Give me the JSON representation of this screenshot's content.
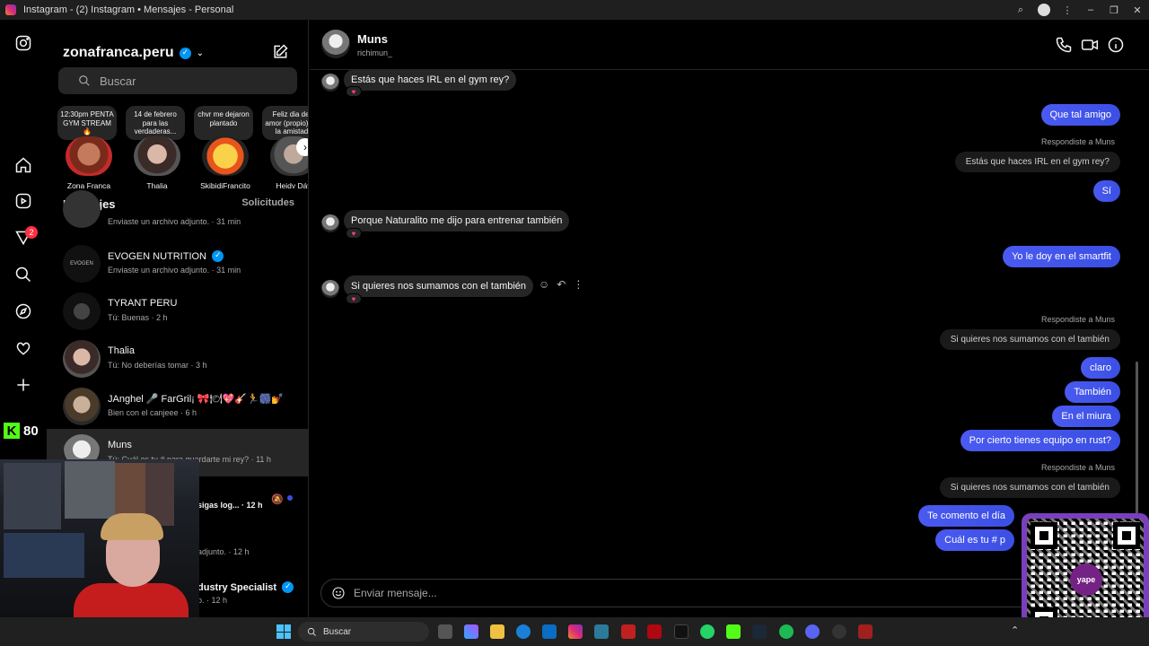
{
  "window": {
    "title": "Instagram - (2) Instagram • Mensajes - Personal"
  },
  "rail": {
    "notification_count": "2",
    "kick_count": "80"
  },
  "account": {
    "username": "zonafranca.peru"
  },
  "search": {
    "placeholder": "Buscar"
  },
  "notes": [
    {
      "text": "12:30pm PENTA GYM STREAM 🔥",
      "name": "Zona Franca"
    },
    {
      "text": "14 de febrero para las verdaderas...",
      "name": "Thalia"
    },
    {
      "text": "chvr me dejaron plantado",
      "name": "SkibidiFrancito"
    },
    {
      "text": "Feliz dia del amor (propio) de la amistad",
      "name": "Heidy Dáv"
    }
  ],
  "inbox": {
    "title": "Mensajes",
    "requests": "Solicitudes",
    "conversations": [
      {
        "name": "",
        "preview": "Enviaste un archivo adjunto. · 31 min"
      },
      {
        "name": "EVOGEN NUTRITION",
        "preview": "Enviaste un archivo adjunto. · 31 min",
        "avatar_text": "EVOGEN"
      },
      {
        "name": "TYRANT PERU",
        "preview": "Tú: Buenas · 2 h"
      },
      {
        "name": "Thalia",
        "preview": "Tú: No deberías tomar · 3 h"
      },
      {
        "name": "JAnghel 🎤 FarGril¡ 🎀🍽💖🎸🏃🎆💅",
        "preview": "Bien con el canjeee · 6 h"
      },
      {
        "name": "Muns",
        "preview": "Tú: Cuál es tu # para guardarte mi rey? · 11 h"
      },
      {
        "name": "",
        "preview": "sigas log... · 12 h"
      },
      {
        "name": "",
        "preview": "adjunto. · 12 h"
      },
      {
        "name": "dustry Specialist",
        "preview": "o. · 12 h"
      }
    ]
  },
  "chat": {
    "name": "Muns",
    "username": "richimun_",
    "messages": {
      "in1": "Estás que haces IRL en el gym rey?",
      "out1": "Que tal amigo",
      "reply_label_1": "Respondiste a Muns",
      "quote1": "Estás que haces IRL en el gym rey?",
      "out2": "Sí",
      "in2": "Porque Naturalito me dijo para entrenar también",
      "out3": "Yo le doy en el smartfit",
      "in3": "Si quieres nos sumamos con el también",
      "reply_label_2": "Respondiste a Muns",
      "quote2": "Si quieres nos sumamos con el también",
      "out4": "claro",
      "out5": "También",
      "out6": "En el miura",
      "out7": "Por cierto tienes equipo en rust?",
      "reply_label_3": "Respondiste a Muns",
      "quote3": "Si quieres nos sumamos con el también",
      "out8": "Te comento el día",
      "out9": "Cuál es tu # p"
    },
    "composer_placeholder": "Enviar mensaje..."
  },
  "qr": {
    "brand": "yape"
  },
  "taskbar": {
    "search_label": "Buscar"
  }
}
